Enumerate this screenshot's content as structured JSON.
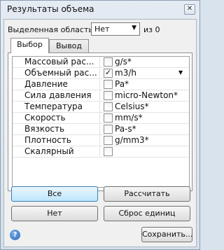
{
  "window": {
    "title": "Результаты объема",
    "close_glyph": "✕"
  },
  "selection": {
    "label": "Выделенная область:",
    "value": "Нет",
    "count": "из 0"
  },
  "tabs": [
    {
      "label": "Выбор",
      "active": true
    },
    {
      "label": "Вывод",
      "active": false
    }
  ],
  "rows": [
    {
      "label": "Массовый рас...",
      "checked": false,
      "unit": "g/s*"
    },
    {
      "label": "Объемный рас...",
      "checked": true,
      "unit": "m3/h",
      "has_dropdown": true
    },
    {
      "label": "Давление",
      "checked": false,
      "unit": "Pa*"
    },
    {
      "label": "Сила давления",
      "checked": false,
      "unit": "micro-Newton*"
    },
    {
      "label": "Температура",
      "checked": false,
      "unit": "Celsius*"
    },
    {
      "label": "Скорость",
      "checked": false,
      "unit": "mm/s*"
    },
    {
      "label": "Вязкость",
      "checked": false,
      "unit": "Pa-s*"
    },
    {
      "label": "Плотность",
      "checked": false,
      "unit": "g/mm3*"
    },
    {
      "label": "Скалярный",
      "checked": false,
      "unit": ""
    }
  ],
  "buttons": {
    "all": "Все",
    "calculate": "Рассчитать",
    "none": "Нет",
    "reset_units": "Сброс единиц",
    "save": "Сохранить..."
  },
  "icons": {
    "help": "?",
    "check": "✓",
    "dropdown": "▼"
  }
}
